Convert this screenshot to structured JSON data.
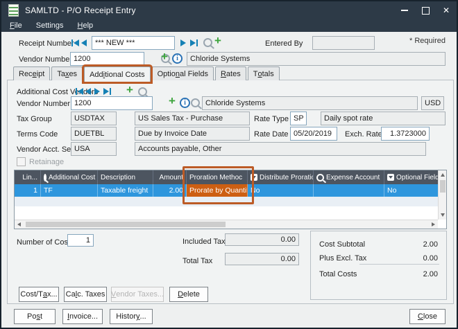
{
  "colors": {
    "titlebar": "#2d3a47",
    "accent_teal": "#1581b5",
    "accent_green": "#3da53d",
    "selection_blue": "#2e96dd",
    "grid_header_gray": "#4d5560",
    "annotation_orange": "#bc5b26",
    "proration_cell_orange": "#cd5f13"
  },
  "window": {
    "title": "SAMLTD - P/O Receipt Entry",
    "menu": [
      {
        "text": "File",
        "u": 0
      },
      {
        "text": "Settings",
        "u": -1
      },
      {
        "text": "Help",
        "u": 0
      }
    ]
  },
  "header": {
    "receipt_number_label": "Receipt Number",
    "receipt_number_value": "*** NEW ***",
    "entered_by_label": "Entered By",
    "entered_by_value": "",
    "required_note": "* Required",
    "vendor_number_label": "Vendor Number",
    "vendor_number_value": "1200",
    "vendor_name": "Chloride Systems"
  },
  "tabs": [
    {
      "text": "Receipt",
      "u": 3
    },
    {
      "text": "Taxes",
      "u": 2
    },
    {
      "text": "Additional Costs",
      "u": 3
    },
    {
      "text": "Optional Fields",
      "u": 5
    },
    {
      "text": "Rates",
      "u": 0
    },
    {
      "text": "Totals",
      "u": 1
    }
  ],
  "active_tab": "Additional Costs",
  "panel": {
    "acv_label": "Additional Cost Vendors",
    "vendor_number_label": "Vendor Number",
    "vendor_number_value": "1200",
    "vendor_name": "Chloride Systems",
    "currency": "USD",
    "tax_group_label": "Tax Group",
    "tax_group_value": "USDTAX",
    "tax_group_desc": "US Sales Tax - Purchase",
    "rate_type_label": "Rate Type",
    "rate_type_value": "SP",
    "rate_type_desc": "Daily spot rate",
    "terms_code_label": "Terms Code",
    "terms_code_value": "DUETBL",
    "terms_code_desc": "Due by Invoice Date",
    "rate_date_label": "Rate Date",
    "rate_date_value": "05/20/2019",
    "exch_rate_label": "Exch. Rate",
    "exch_rate_value": "1.3723000",
    "vendor_acct_label": "Vendor Acct. Set",
    "vendor_acct_value": "USA",
    "vendor_acct_desc": "Accounts payable, Other",
    "retainage_label": "Retainage",
    "grid": {
      "columns": [
        {
          "label": "Lin..."
        },
        {
          "label": "Additional Cost"
        },
        {
          "label": "Description"
        },
        {
          "label": "Amount"
        },
        {
          "label": "Proration Methoc"
        },
        {
          "label": "Distribute Proration"
        },
        {
          "label": "Expense Account"
        },
        {
          "label": "Optional Fields"
        }
      ],
      "row": {
        "line": "1",
        "additional_cost": "TF",
        "description": "Taxable freight",
        "amount": "2.00",
        "proration_method": "Prorate by Quantity",
        "distribute_proration": "No",
        "expense_account": "",
        "optional_fields": "No"
      }
    },
    "number_of_costs_label": "Number of Costs",
    "number_of_costs_value": "1",
    "included_tax_label": "Included Tax",
    "included_tax_value": "0.00",
    "total_tax_label": "Total Tax",
    "total_tax_value": "0.00",
    "totals_box": {
      "cost_subtotal_label": "Cost Subtotal",
      "cost_subtotal_value": "2.00",
      "plus_excl_tax_label": "Plus Excl. Tax",
      "plus_excl_tax_value": "0.00",
      "total_costs_label": "Total Costs",
      "total_costs_value": "2.00"
    },
    "buttons": [
      {
        "text": "Cost/Tax...",
        "u": 6
      },
      {
        "text": "Calc. Taxes",
        "u": 2
      },
      {
        "text": "Vendor Taxes...",
        "u": 0
      },
      {
        "text": "Delete",
        "u": 0
      }
    ]
  },
  "footer": {
    "buttons": [
      {
        "text": "Post",
        "u": 2
      },
      {
        "text": "Invoice...",
        "u": 0
      },
      {
        "text": "History...",
        "u": 6
      },
      {
        "text": "Close",
        "u": 0
      }
    ]
  }
}
